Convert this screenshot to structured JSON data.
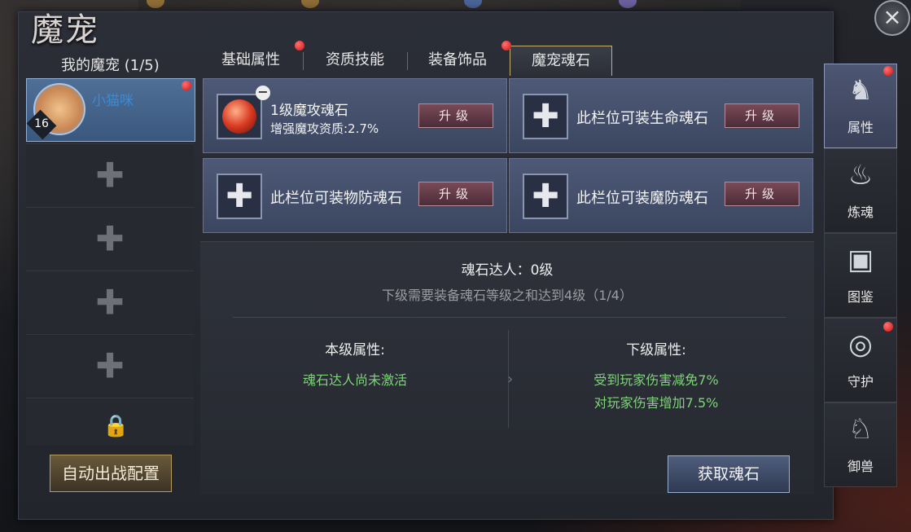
{
  "window": {
    "title": "魔宠",
    "close_icon": "×"
  },
  "pets": {
    "header": "我的魔宠 (1/5)",
    "selected": {
      "name": "小猫咪",
      "level": "16"
    },
    "empty_icon": "✚",
    "lock_icon": "🔒",
    "auto_button": "自动出战配置"
  },
  "tabs": [
    "基础属性",
    "资质技能",
    "装备饰品",
    "魔宠魂石"
  ],
  "stones": {
    "slot1": {
      "name": "1级魔攻魂石",
      "desc": "增强魔攻资质:2.7%",
      "button": "升级"
    },
    "slot2": {
      "label": "此栏位可装生命魂石",
      "button": "升级"
    },
    "slot3": {
      "label": "此栏位可装物防魂石",
      "button": "升级"
    },
    "slot4": {
      "label": "此栏位可装魔防魂石",
      "button": "升级"
    },
    "empty_icon": "✚",
    "remove_icon": "−"
  },
  "info": {
    "master": "魂石达人：0级",
    "requirement": "下级需要装备魂石等级之和达到4级（1/4）",
    "current_title": "本级属性:",
    "current_value": "魂石达人尚未激活",
    "next_title": "下级属性:",
    "next_values": [
      "受到玩家伤害减免7%",
      "对玩家伤害增加7.5%"
    ],
    "get_button": "获取魂石"
  },
  "sidebar": [
    {
      "label": "属性",
      "icon": "♞"
    },
    {
      "label": "炼魂",
      "icon": "♨"
    },
    {
      "label": "图鉴",
      "icon": "▣"
    },
    {
      "label": "守护",
      "icon": "◎"
    },
    {
      "label": "御兽",
      "icon": "♘"
    }
  ],
  "colors": {
    "accent_red": "#d11010",
    "positive_text": "#7fd37a",
    "pet_name": "#3a8bd6"
  }
}
